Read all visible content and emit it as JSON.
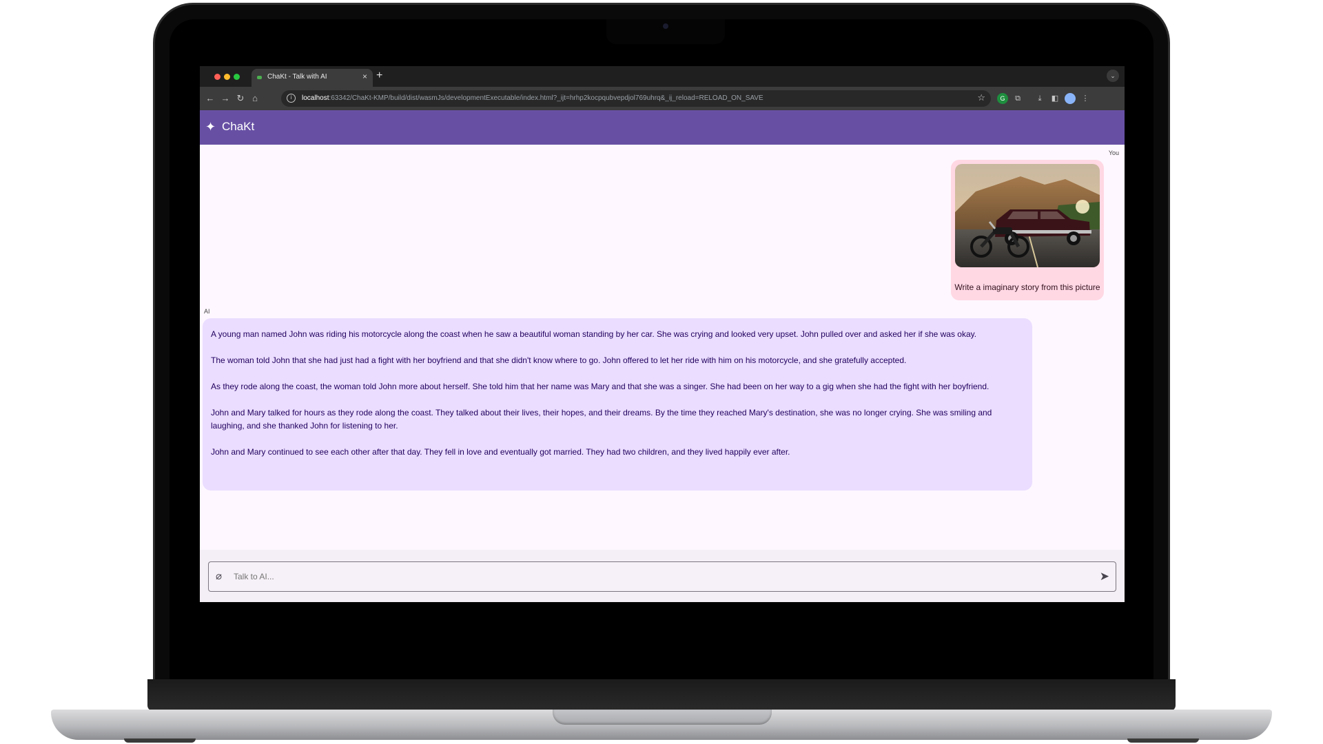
{
  "browser": {
    "tab_title": "ChaKt - Talk with AI",
    "tab_close": "×",
    "new_tab": "+",
    "url_host": "localhost",
    "url_path": ":63342/ChaKt-KMP/build/dist/wasmJs/developmentExecutable/index.html?_ijt=hrhp2kocpqubvepdjol769uhrq&_ij_reload=RELOAD_ON_SAVE"
  },
  "app": {
    "title": "ChaKt",
    "header_color": "#6750a4"
  },
  "chat": {
    "user_label": "You",
    "user_message": "Write a imaginary story from this picture",
    "user_image_icon": "photo-classic-car-and-motorcycle",
    "ai_label": "AI",
    "ai_paragraphs": [
      " A young man named John was riding his motorcycle along the coast when he saw a beautiful woman standing by her car. She was crying and looked very upset. John pulled over and asked her if she was okay.",
      "The woman told John that she had just had a fight with her boyfriend and that she didn't know where to go. John offered to let her ride with him on his motorcycle, and she gratefully accepted.",
      "As they rode along the coast, the woman told John more about herself. She told him that her name was Mary and that she was a singer. She had been on her way to a gig when she had the fight with her boyfriend.",
      "John and Mary talked for hours as they rode along the coast. They talked about their lives, their hopes, and their dreams. By the time they reached Mary's destination, she was no longer crying. She was smiling and laughing, and she thanked John for listening to her.",
      "John and Mary continued to see each other after that day. They fell in love and eventually got married. They had two children, and they lived happily ever after."
    ]
  },
  "input": {
    "placeholder": "Talk to AI..."
  }
}
